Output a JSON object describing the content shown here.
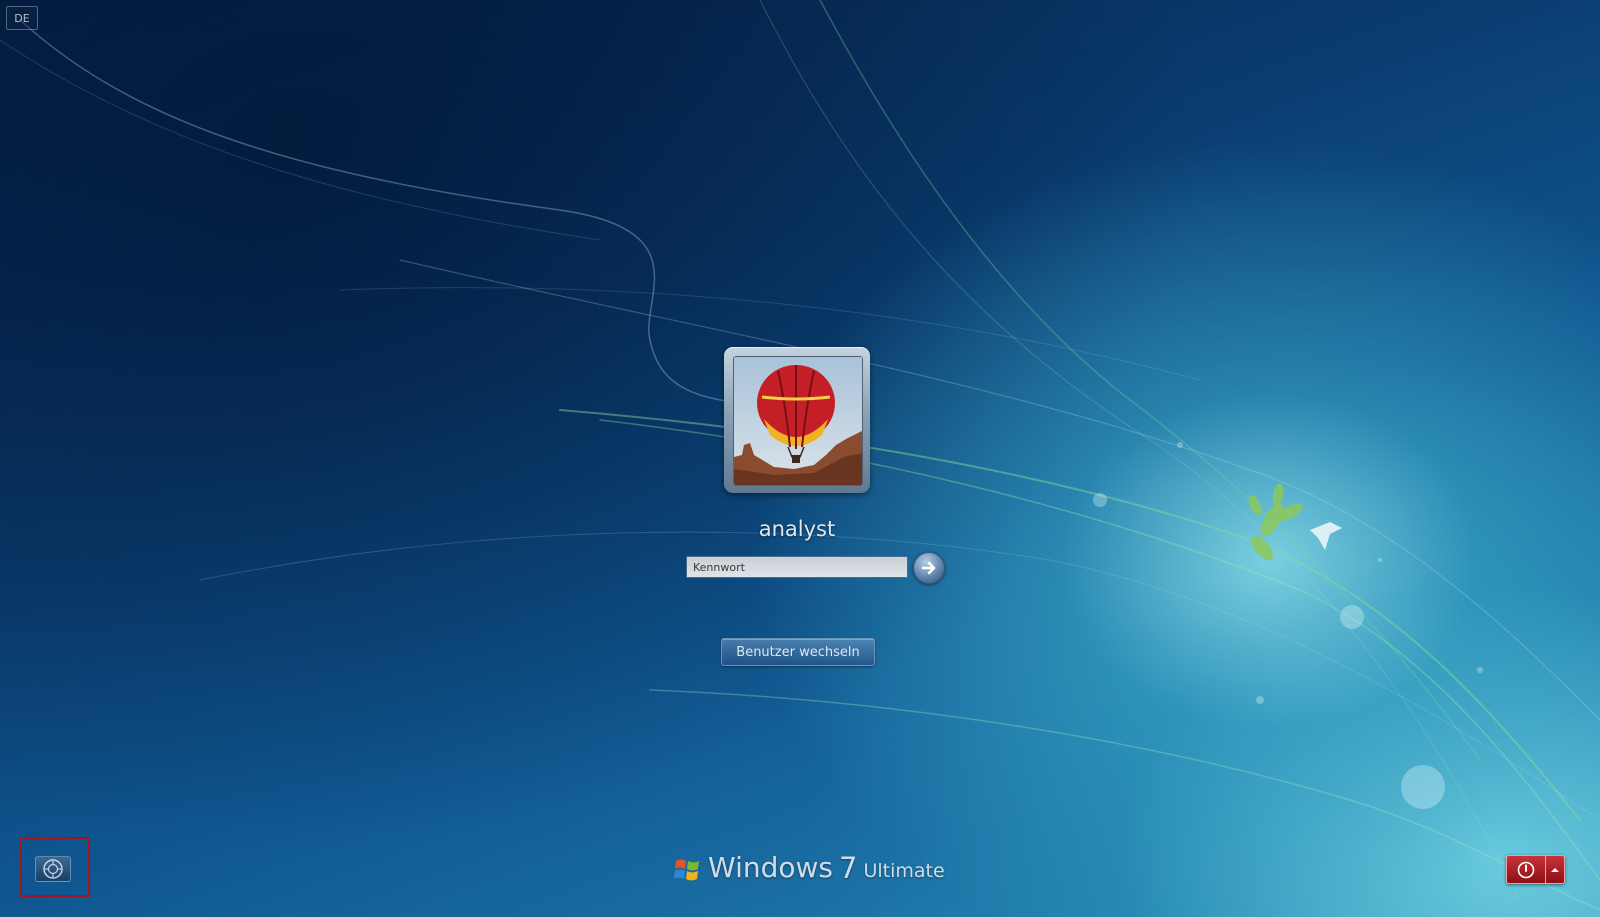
{
  "language_indicator": "DE",
  "user": {
    "name": "analyst",
    "avatar_icon": "hot-air-balloon-picture"
  },
  "login": {
    "password_placeholder": "Kennwort",
    "submit_icon": "arrow-right-icon"
  },
  "switch_user_label": "Benutzer wechseln",
  "ease_of_access_icon": "ease-of-access-icon",
  "branding": {
    "name": "Windows",
    "version": "7",
    "edition": "Ultimate"
  },
  "power": {
    "shutdown_icon": "power-icon",
    "options_icon": "chevron-up-icon"
  }
}
